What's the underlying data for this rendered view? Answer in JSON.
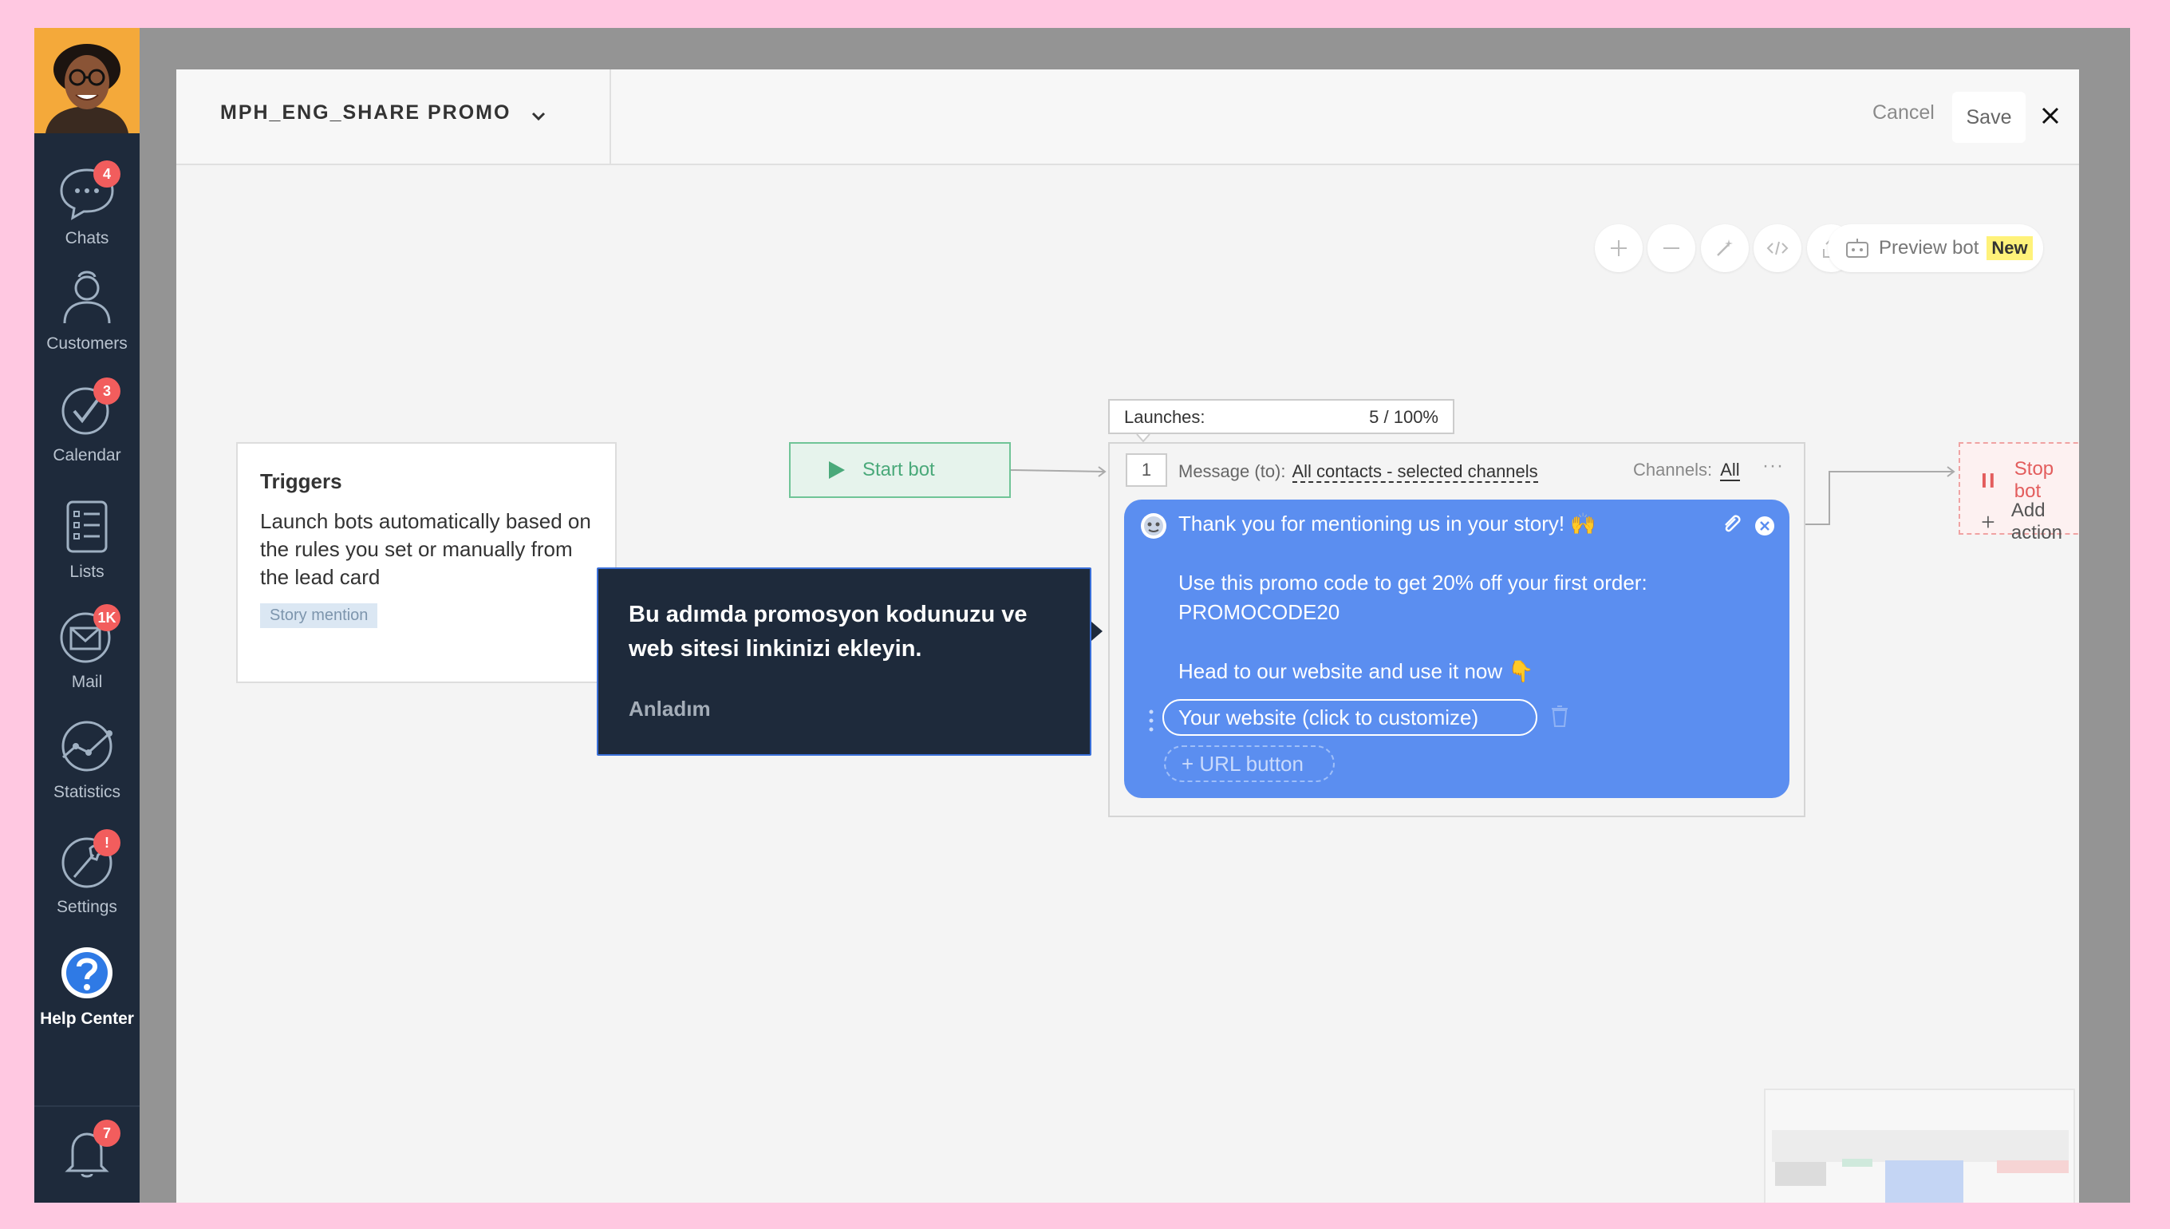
{
  "sidebar": {
    "items": [
      {
        "label": "Chats",
        "badge": "4",
        "icon": "chat-icon"
      },
      {
        "label": "Customers",
        "badge": "",
        "icon": "customers-icon"
      },
      {
        "label": "Calendar",
        "badge": "3",
        "icon": "calendar-check-icon"
      },
      {
        "label": "Lists",
        "badge": "",
        "icon": "lists-icon"
      },
      {
        "label": "Mail",
        "badge": "1K",
        "icon": "mail-icon"
      },
      {
        "label": "Statistics",
        "badge": "",
        "icon": "statistics-icon"
      },
      {
        "label": "Settings",
        "badge": "!",
        "icon": "settings-icon"
      },
      {
        "label": "Help Center",
        "badge": "",
        "icon": "help-icon"
      }
    ],
    "notifications_badge": "7"
  },
  "header": {
    "bot_name": "MPH_ENG_SHARE PROMO C",
    "cancel_label": "Cancel",
    "save_label": "Save"
  },
  "toolbar": {
    "preview_label": "Preview bot",
    "new_tag": "New"
  },
  "triggers": {
    "title": "Triggers",
    "description": "Launch bots automatically based on the rules you set or manually from the lead card",
    "tag": "Story mention"
  },
  "start": {
    "label": "Start bot"
  },
  "launches": {
    "label": "Launches:",
    "value": "5 / 100%"
  },
  "message": {
    "step": "1",
    "to_label": "Message (to):",
    "to_value": "All contacts - selected channels",
    "channels_label": "Channels:",
    "channels_value": "All",
    "more": "···",
    "lines": [
      "Thank you for mentioning us in your story! 🙌",
      "",
      "Use this promo code to get 20% off your first order:",
      "PROMOCODE20",
      "",
      "Head to our website and use it now 👇"
    ],
    "website_button": "Your website (click to customize)",
    "url_button": "+ URL button"
  },
  "stop": {
    "stop_label": "Stop bot",
    "add_action_label": "Add action"
  },
  "tooltip": {
    "text": "Bu adımda promosyon kodunuzu ve web sitesi linkinizi ekleyin.",
    "ok": "Anladım"
  },
  "colors": {
    "sidebar_bg": "#1e2a3b",
    "badge": "#f25d5d",
    "bubble": "#5b8ef0",
    "start_green": "#4aa97a",
    "stop_red": "#e35d5d",
    "new_tag": "#fff27a"
  }
}
